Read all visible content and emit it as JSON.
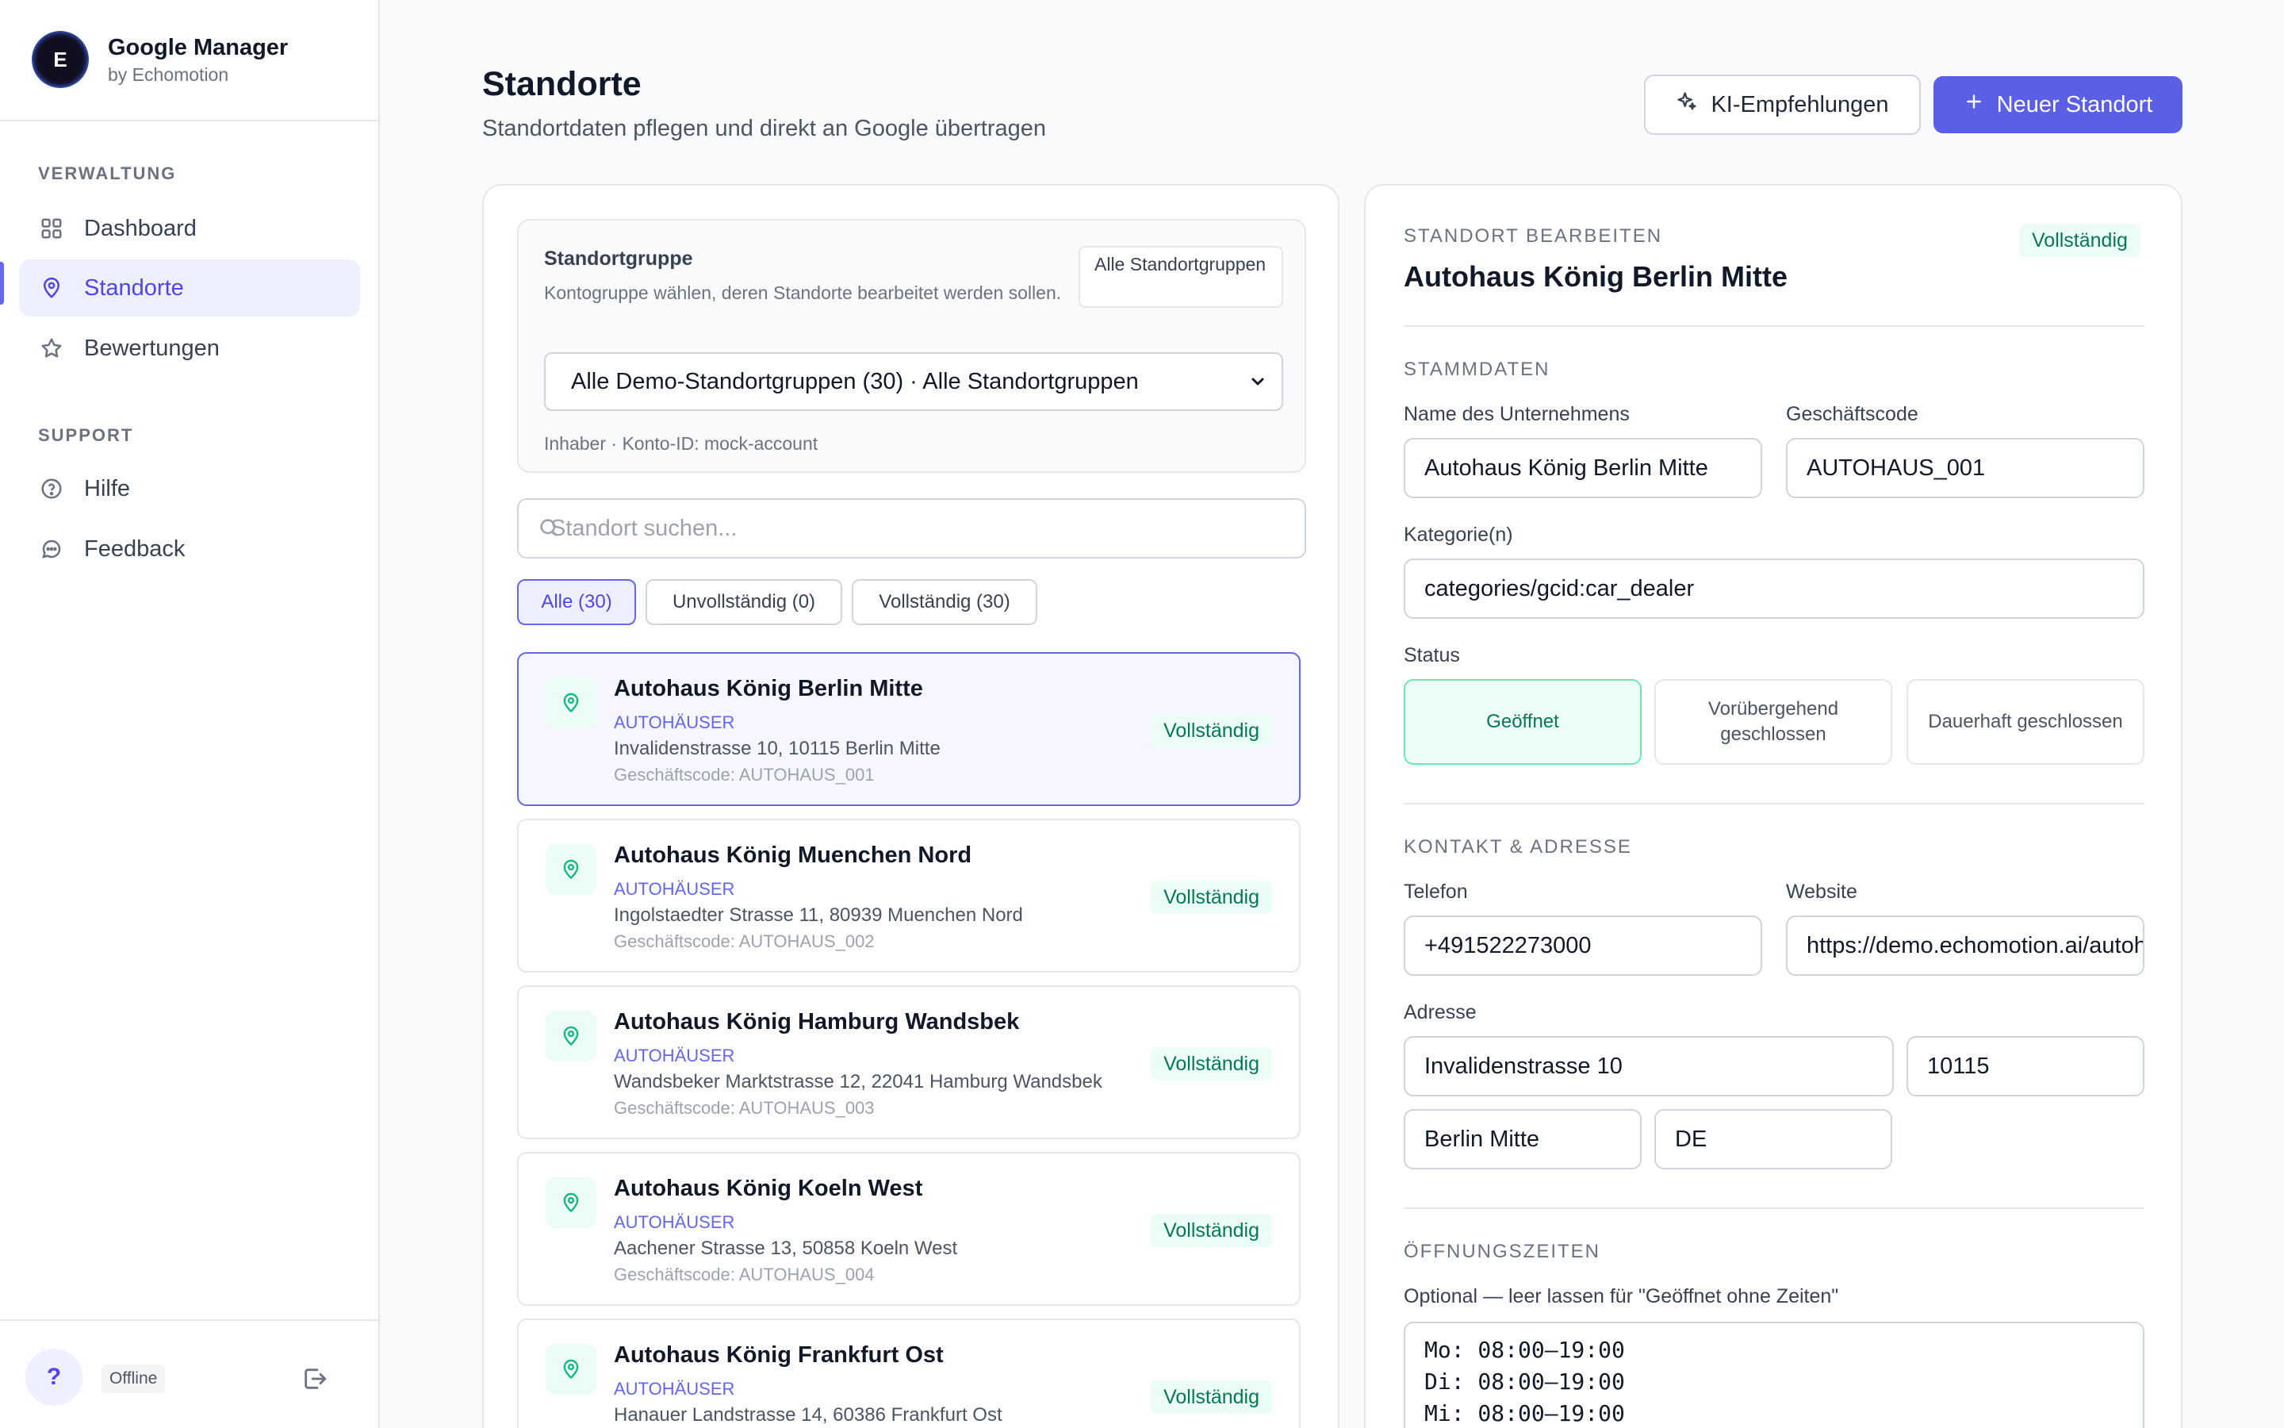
{
  "brand": {
    "logo_letter": "E",
    "title": "Google Manager",
    "subtitle": "by Echomotion"
  },
  "sidebar": {
    "sections": [
      {
        "label": "VERWALTUNG"
      },
      {
        "label": "SUPPORT"
      }
    ],
    "items": [
      {
        "label": "Dashboard",
        "icon": "grid-icon"
      },
      {
        "label": "Standorte",
        "icon": "map-pin-icon",
        "active": true
      },
      {
        "label": "Bewertungen",
        "icon": "star-icon"
      },
      {
        "label": "Hilfe",
        "icon": "help-circle-icon"
      },
      {
        "label": "Feedback",
        "icon": "chat-bubble-icon"
      }
    ],
    "footer": {
      "help_label": "?",
      "status": "Offline",
      "logout_icon": "logout-icon"
    }
  },
  "header": {
    "title": "Standorte",
    "subtitle": "Standortdaten pflegen und direkt an Google übertragen",
    "ai_button": "KI-Empfehlungen",
    "new_button": "Neuer Standort"
  },
  "group": {
    "title": "Standortgruppe",
    "description": "Kontogruppe wählen, deren Standorte bearbeitet werden sollen.",
    "chip": "Alle Standortgruppen",
    "selected": "Alle Demo-Standortgruppen (30) · Alle Standortgruppen",
    "meta": "Inhaber · Konto-ID: mock-account"
  },
  "search": {
    "placeholder": "Standort suchen..."
  },
  "filters": [
    {
      "label": "Alle (30)",
      "active": true
    },
    {
      "label": "Unvollständig (0)"
    },
    {
      "label": "Vollständig (30)"
    }
  ],
  "locations": [
    {
      "name": "Autohaus König Berlin Mitte",
      "category": "AUTOHÄUSER",
      "address": "Invalidenstrasse 10, 10115 Berlin Mitte",
      "code": "Geschäftscode: AUTOHAUS_001",
      "status": "Vollständig"
    },
    {
      "name": "Autohaus König Muenchen Nord",
      "category": "AUTOHÄUSER",
      "address": "Ingolstaedter Strasse 11, 80939 Muenchen Nord",
      "code": "Geschäftscode: AUTOHAUS_002",
      "status": "Vollständig"
    },
    {
      "name": "Autohaus König Hamburg Wandsbek",
      "category": "AUTOHÄUSER",
      "address": "Wandsbeker Marktstrasse 12, 22041 Hamburg Wandsbek",
      "code": "Geschäftscode: AUTOHAUS_003",
      "status": "Vollständig"
    },
    {
      "name": "Autohaus König Koeln West",
      "category": "AUTOHÄUSER",
      "address": "Aachener Strasse 13, 50858 Koeln West",
      "code": "Geschäftscode: AUTOHAUS_004",
      "status": "Vollständig"
    },
    {
      "name": "Autohaus König Frankfurt Ost",
      "category": "AUTOHÄUSER",
      "address": "Hanauer Landstrasse 14, 60386 Frankfurt Ost",
      "code": "",
      "status": "Vollständig"
    }
  ],
  "editor": {
    "overline": "STANDORT BEARBEITEN",
    "title": "Autohaus König Berlin Mitte",
    "badge": "Vollständig",
    "stamm": {
      "section": "STAMMDATEN",
      "name_label": "Name des Unternehmens",
      "name_value": "Autohaus König Berlin Mitte",
      "code_label": "Geschäftscode",
      "code_value": "AUTOHAUS_001",
      "category_label": "Kategorie(n)",
      "category_value": "categories/gcid:car_dealer",
      "status_label": "Status",
      "status_options": [
        "Geöffnet",
        "Vorübergehend geschlossen",
        "Dauerhaft geschlossen"
      ]
    },
    "kontakt": {
      "section": "KONTAKT & ADRESSE",
      "phone_label": "Telefon",
      "phone_value": "+491522273000",
      "website_label": "Website",
      "website_value": "https://demo.echomotion.ai/autohaus",
      "address_label": "Adresse",
      "street": "Invalidenstrasse 10",
      "zip": "10115",
      "city": "Berlin Mitte",
      "country": "DE"
    },
    "hours": {
      "section": "ÖFFNUNGSZEITEN",
      "hint": "Optional — leer lassen für \"Geöffnet ohne Zeiten\"",
      "lines": [
        "Mo: 08:00–19:00",
        "Di: 08:00–19:00",
        "Mi: 08:00–19:00"
      ]
    }
  },
  "colors": {
    "accent": "#5b5fe6",
    "success": "#047857",
    "success_bg": "#ecfdf5"
  }
}
